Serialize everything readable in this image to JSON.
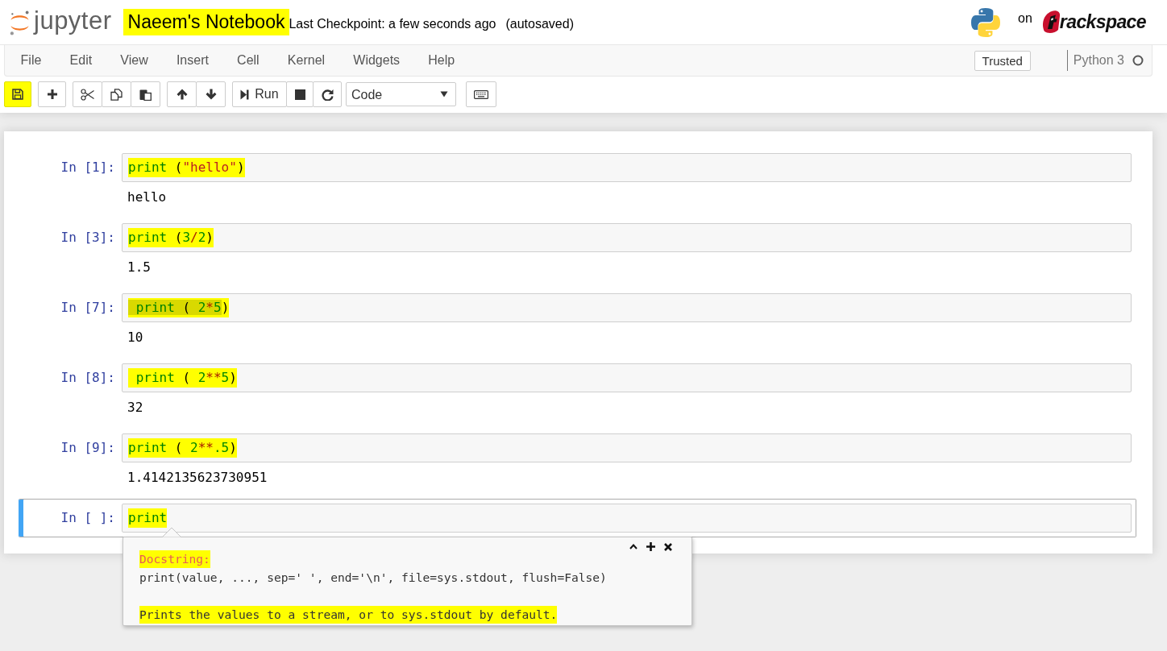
{
  "header": {
    "logo_text": "jupyter",
    "notebook_title": "Naeem's Notebook",
    "title_highlighted": true,
    "checkpoint": "Last Checkpoint: a few seconds ago",
    "autosave_status": "(autosaved)",
    "on_label": "on",
    "brand_text": "rackspace"
  },
  "menubar": {
    "items": [
      "File",
      "Edit",
      "View",
      "Insert",
      "Cell",
      "Kernel",
      "Widgets",
      "Help"
    ],
    "trusted_button": "Trusted",
    "kernel_name": "Python 3",
    "kernel_busy": false
  },
  "toolbar": {
    "save_highlighted": true,
    "run_label": "Run",
    "cell_type": "Code"
  },
  "cells": [
    {
      "prompt": "In [1]:",
      "selected": false,
      "highlighted": true,
      "tokens": [
        {
          "text": "print",
          "kind": "builtin",
          "selected": false
        },
        {
          "text": " (",
          "kind": "plain",
          "selected": false
        },
        {
          "text": "\"hello\"",
          "kind": "string",
          "selected": false
        },
        {
          "text": ")",
          "kind": "plain",
          "selected": false
        }
      ],
      "output": "hello"
    },
    {
      "prompt": "In [3]:",
      "selected": false,
      "highlighted": true,
      "tokens": [
        {
          "text": "print",
          "kind": "builtin",
          "selected": false
        },
        {
          "text": " (",
          "kind": "plain",
          "selected": false
        },
        {
          "text": "3",
          "kind": "number",
          "selected": false
        },
        {
          "text": "/",
          "kind": "operator",
          "selected": false
        },
        {
          "text": "2",
          "kind": "number",
          "selected": false
        },
        {
          "text": ")",
          "kind": "plain",
          "selected": false
        }
      ],
      "output": "1.5"
    },
    {
      "prompt": "In [7]:",
      "selected": false,
      "highlighted": true,
      "tokens": [
        {
          "text": " print",
          "kind": "builtin",
          "selected": true
        },
        {
          "text": " ( ",
          "kind": "plain",
          "selected": true
        },
        {
          "text": "2",
          "kind": "number",
          "selected": true
        },
        {
          "text": "*",
          "kind": "operator",
          "selected": true
        },
        {
          "text": "5",
          "kind": "number",
          "selected": true
        },
        {
          "text": ")",
          "kind": "plain",
          "selected": false
        }
      ],
      "output": "10"
    },
    {
      "prompt": "In [8]:",
      "selected": false,
      "highlighted": true,
      "tokens": [
        {
          "text": " print",
          "kind": "builtin",
          "selected": false
        },
        {
          "text": " ( ",
          "kind": "plain",
          "selected": false
        },
        {
          "text": "2",
          "kind": "number",
          "selected": false
        },
        {
          "text": "**",
          "kind": "operator",
          "selected": false
        },
        {
          "text": "5",
          "kind": "number",
          "selected": false
        },
        {
          "text": ")",
          "kind": "plain",
          "selected": false
        }
      ],
      "output": "32"
    },
    {
      "prompt": "In [9]:",
      "selected": false,
      "highlighted": true,
      "tokens": [
        {
          "text": "print",
          "kind": "builtin",
          "selected": false
        },
        {
          "text": " ( ",
          "kind": "plain",
          "selected": false
        },
        {
          "text": "2",
          "kind": "number",
          "selected": false
        },
        {
          "text": "**",
          "kind": "operator",
          "selected": false
        },
        {
          "text": ".5",
          "kind": "number",
          "selected": false
        },
        {
          "text": ")",
          "kind": "plain",
          "selected": false
        }
      ],
      "output": "1.4142135623730951"
    },
    {
      "prompt": "In [ ]:",
      "selected": true,
      "highlighted": true,
      "tokens": [
        {
          "text": "print",
          "kind": "builtin",
          "selected": false
        }
      ]
    }
  ],
  "tooltip": {
    "heading": "Docstring:",
    "heading_highlighted": true,
    "signature": "print(value, ..., sep=' ', end='\\n', file=sys.stdout, flush=False)",
    "description": "Prints the values to a stream, or to sys.stdout by default.",
    "description_highlighted": true
  }
}
